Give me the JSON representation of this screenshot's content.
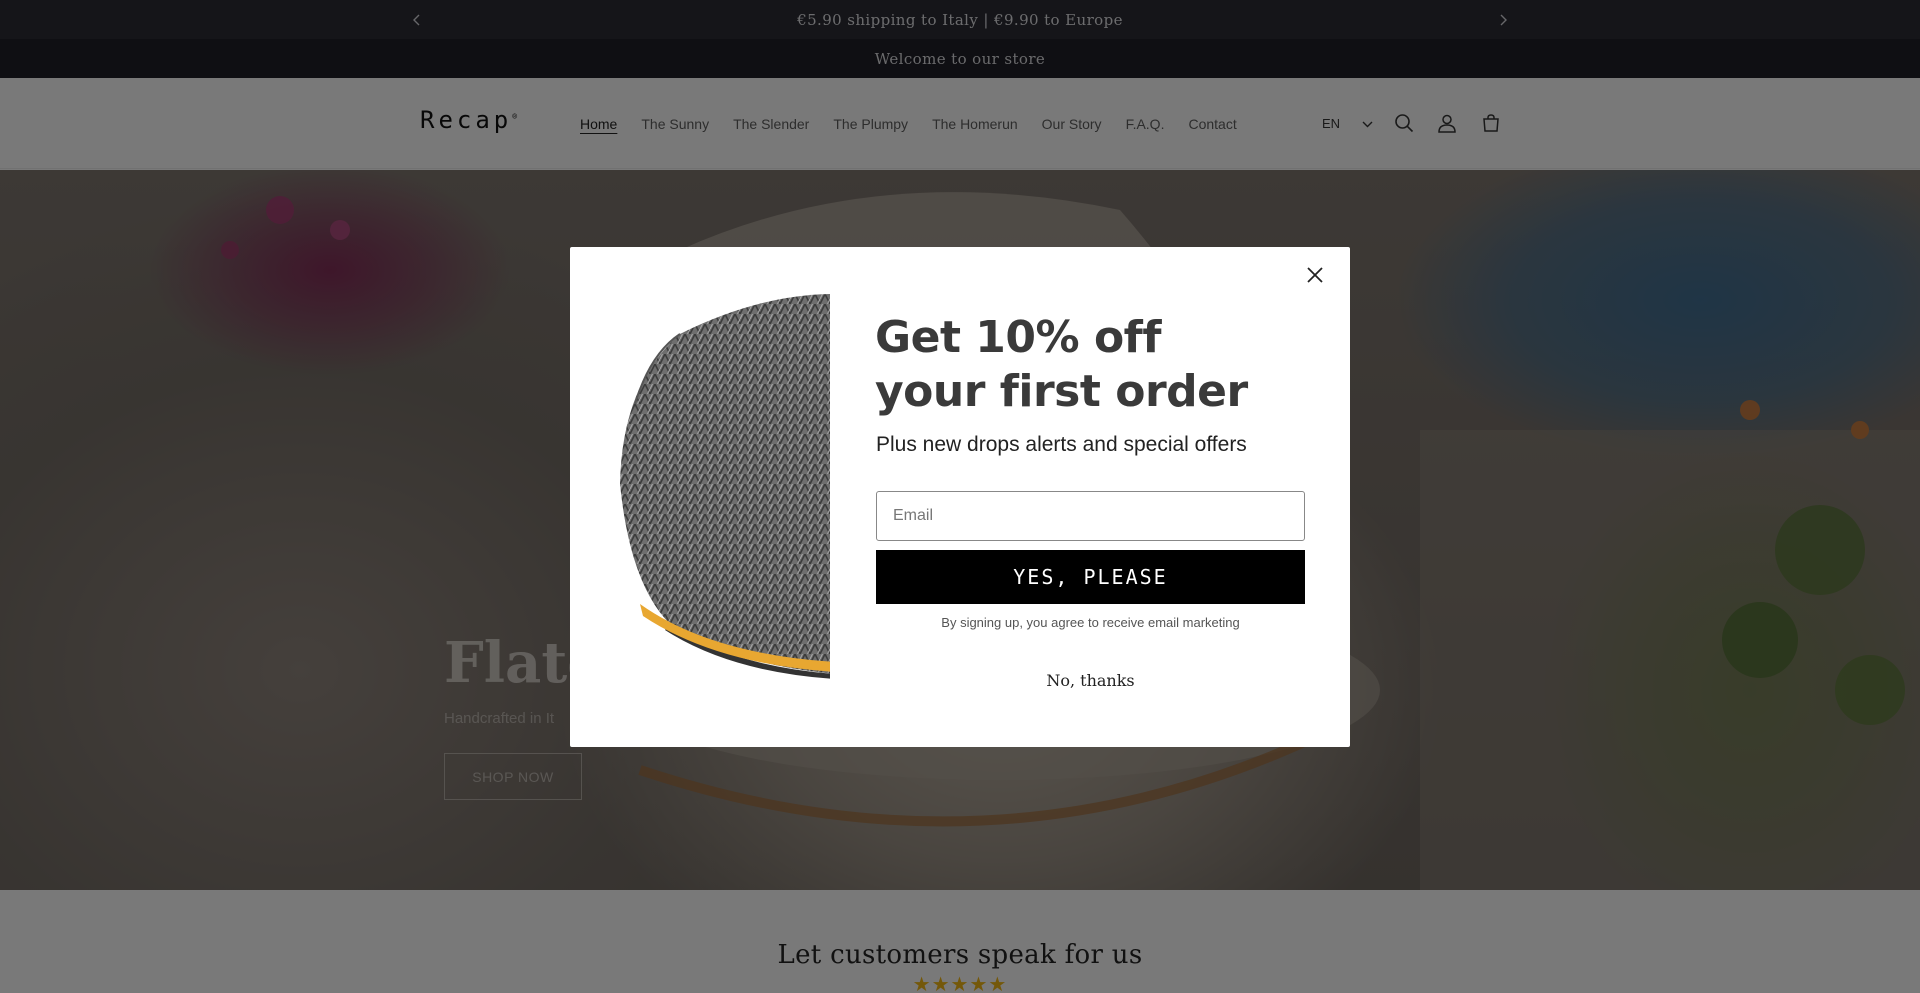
{
  "announcement": {
    "shipping_text": "€5.90 shipping to Italy | €9.90 to Europe",
    "welcome_text": "Welcome to our store",
    "prev_icon": "chevron-left-icon",
    "next_icon": "chevron-right-icon"
  },
  "header": {
    "logo": "Recap",
    "logo_mark": "®",
    "nav": [
      {
        "label": "Home",
        "active": true
      },
      {
        "label": "The Sunny"
      },
      {
        "label": "The Slender"
      },
      {
        "label": "The Plumpy"
      },
      {
        "label": "The Homerun"
      },
      {
        "label": "Our Story"
      },
      {
        "label": "F.A.Q."
      },
      {
        "label": "Contact"
      }
    ],
    "language": "EN",
    "icons": [
      "chevron-down-icon",
      "search-icon",
      "account-icon",
      "cart-icon"
    ]
  },
  "hero": {
    "title": "Flatc",
    "subtitle": "Handcrafted in It",
    "button": "SHOP NOW"
  },
  "reviews": {
    "heading": "Let customers speak for us",
    "stars": "★★★★★"
  },
  "popup": {
    "title_line1": "Get 10% off",
    "title_line2": "your first order",
    "subtitle": "Plus new drops alerts and special offers",
    "email_placeholder": "Email",
    "submit_label": "YES, PLEASE",
    "consent_text": "By signing up, you agree to receive email marketing",
    "decline_label": "No, thanks",
    "close_icon": "close-icon"
  },
  "colors": {
    "announce_bar": "#2a2b33",
    "welcome_bar": "#1e1f26",
    "button_bg": "#000000",
    "star_color": "#e8b014",
    "cap_trim": "#e8a731"
  }
}
